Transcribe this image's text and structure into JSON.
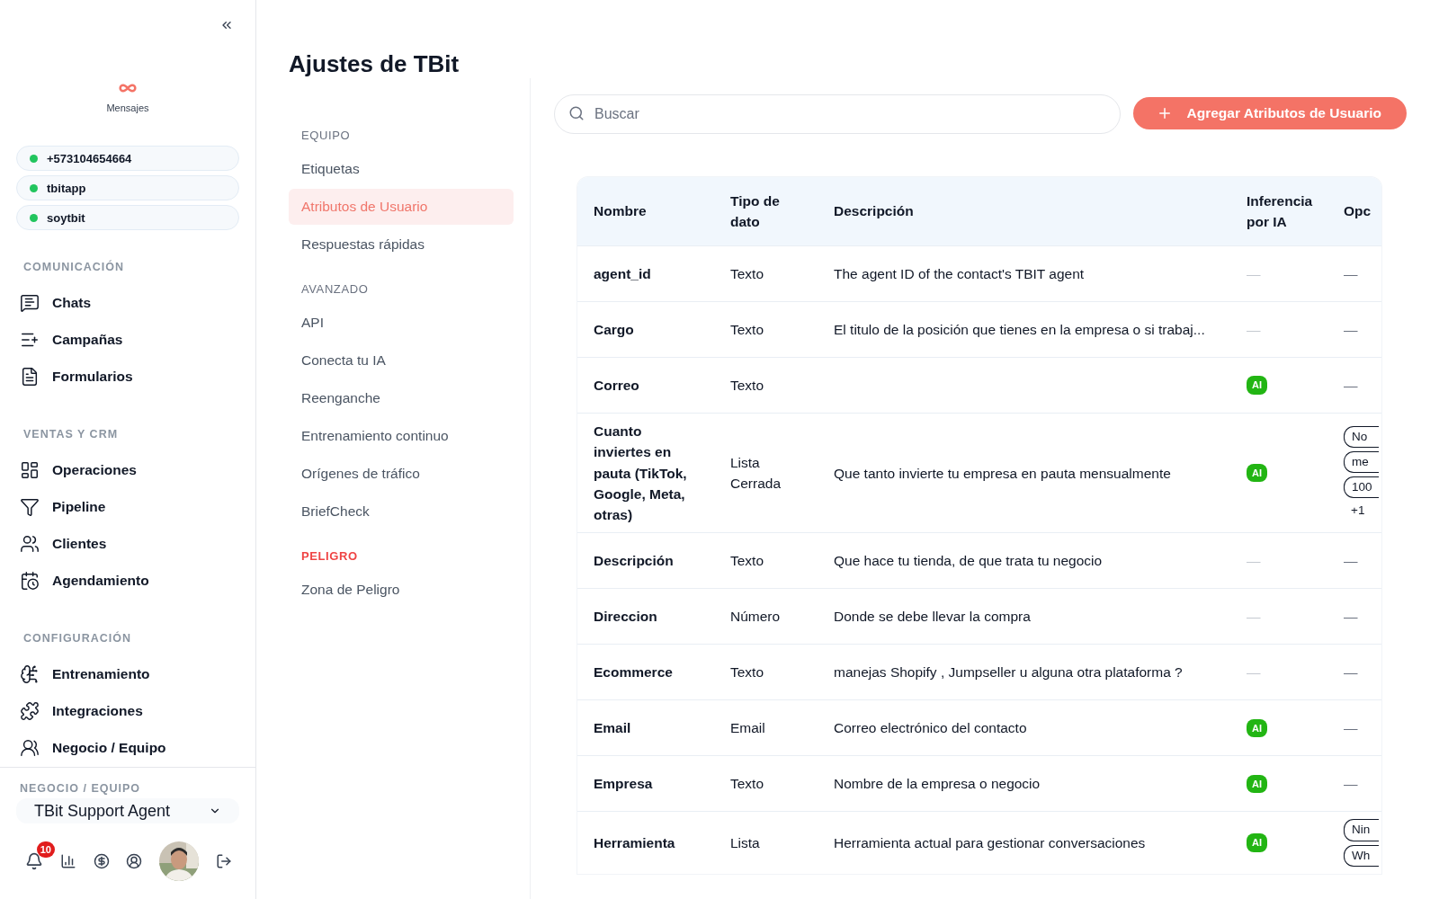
{
  "sidebar": {
    "app_label": "Mensajes",
    "channels": [
      {
        "name": "+573104654664",
        "online": true
      },
      {
        "name": "tbitapp",
        "online": true
      },
      {
        "name": "soytbit",
        "online": true
      }
    ],
    "sections": [
      {
        "title": "COMUNICACIÓN",
        "items": [
          {
            "label": "Chats"
          },
          {
            "label": "Campañas"
          },
          {
            "label": "Formularios"
          }
        ]
      },
      {
        "title": "VENTAS Y CRM",
        "items": [
          {
            "label": "Operaciones"
          },
          {
            "label": "Pipeline"
          },
          {
            "label": "Clientes"
          },
          {
            "label": "Agendamiento"
          }
        ]
      },
      {
        "title": "CONFIGURACIÓN",
        "items": [
          {
            "label": "Entrenamiento"
          },
          {
            "label": "Integraciones"
          },
          {
            "label": "Negocio / Equipo"
          }
        ]
      }
    ],
    "business": {
      "label": "NEGOCIO / EQUIPO",
      "value": "TBit Support Agent"
    },
    "notifications": "10"
  },
  "page": {
    "title": "Ajustes de TBit"
  },
  "settings_nav": [
    {
      "title": "EQUIPO",
      "danger": false,
      "items": [
        {
          "label": "Etiquetas",
          "selected": false
        },
        {
          "label": "Atributos de Usuario",
          "selected": true
        },
        {
          "label": "Respuestas rápidas",
          "selected": false
        }
      ]
    },
    {
      "title": "AVANZADO",
      "danger": false,
      "items": [
        {
          "label": "API",
          "selected": false
        },
        {
          "label": "Conecta tu IA",
          "selected": false
        },
        {
          "label": "Reenganche",
          "selected": false
        },
        {
          "label": "Entrenamiento continuo",
          "selected": false
        },
        {
          "label": "Orígenes de tráfico",
          "selected": false
        },
        {
          "label": "BriefCheck",
          "selected": false
        }
      ]
    },
    {
      "title": "PELIGRO",
      "danger": true,
      "items": [
        {
          "label": "Zona de Peligro",
          "selected": false
        }
      ]
    }
  ],
  "search": {
    "placeholder": "Buscar"
  },
  "add_button": "Agregar Atributos de Usuario",
  "table": {
    "columns": [
      "Nombre",
      "Tipo de dato",
      "Descripción",
      "Inferencia por IA",
      "Opc"
    ],
    "rows": [
      {
        "name": "agent_id",
        "type": "Texto",
        "description": "The agent ID of the contact's TBIT agent",
        "ai": false,
        "inference": "—",
        "options": [],
        "options_empty": "—"
      },
      {
        "name": "Cargo",
        "type": "Texto",
        "description": "El titulo de la posición que tienes en la empresa o si trabaj...",
        "ai": false,
        "inference": "—",
        "options": [],
        "options_empty": "—"
      },
      {
        "name": "Correo",
        "type": "Texto",
        "description": "",
        "ai": true,
        "inference": "AI",
        "options": [],
        "options_empty": "—"
      },
      {
        "name": "Cuanto inviertes en pauta (TikTok, Google, Meta, otras)",
        "type": "Lista Cerrada",
        "description": "Que tanto invierte tu empresa en pauta mensualmente",
        "ai": true,
        "inference": "AI",
        "options": [
          "No",
          "me",
          "100"
        ],
        "options_more": "+1"
      },
      {
        "name": "Descripción",
        "type": "Texto",
        "description": "Que hace tu tienda, de que trata tu negocio",
        "ai": false,
        "inference": "—",
        "options": [],
        "options_empty": "—"
      },
      {
        "name": "Direccion",
        "type": "Número",
        "description": "Donde se debe llevar la compra",
        "ai": false,
        "inference": "—",
        "options": [],
        "options_empty": "—"
      },
      {
        "name": "Ecommerce",
        "type": "Texto",
        "description": "manejas Shopify , Jumpseller u alguna otra plataforma ?",
        "ai": false,
        "inference": "—",
        "options": [],
        "options_empty": "—"
      },
      {
        "name": "Email",
        "type": "Email",
        "description": "Correo electrónico del contacto",
        "ai": true,
        "inference": "AI",
        "options": [],
        "options_empty": "—"
      },
      {
        "name": "Empresa",
        "type": "Texto",
        "description": "Nombre de la empresa o negocio",
        "ai": true,
        "inference": "AI",
        "options": [],
        "options_empty": "—"
      },
      {
        "name": "Herramienta",
        "type": "Lista",
        "description": "Herramienta actual para gestionar conversaciones",
        "ai": true,
        "inference": "AI",
        "options": [
          "Nin",
          "Wh"
        ]
      }
    ]
  }
}
